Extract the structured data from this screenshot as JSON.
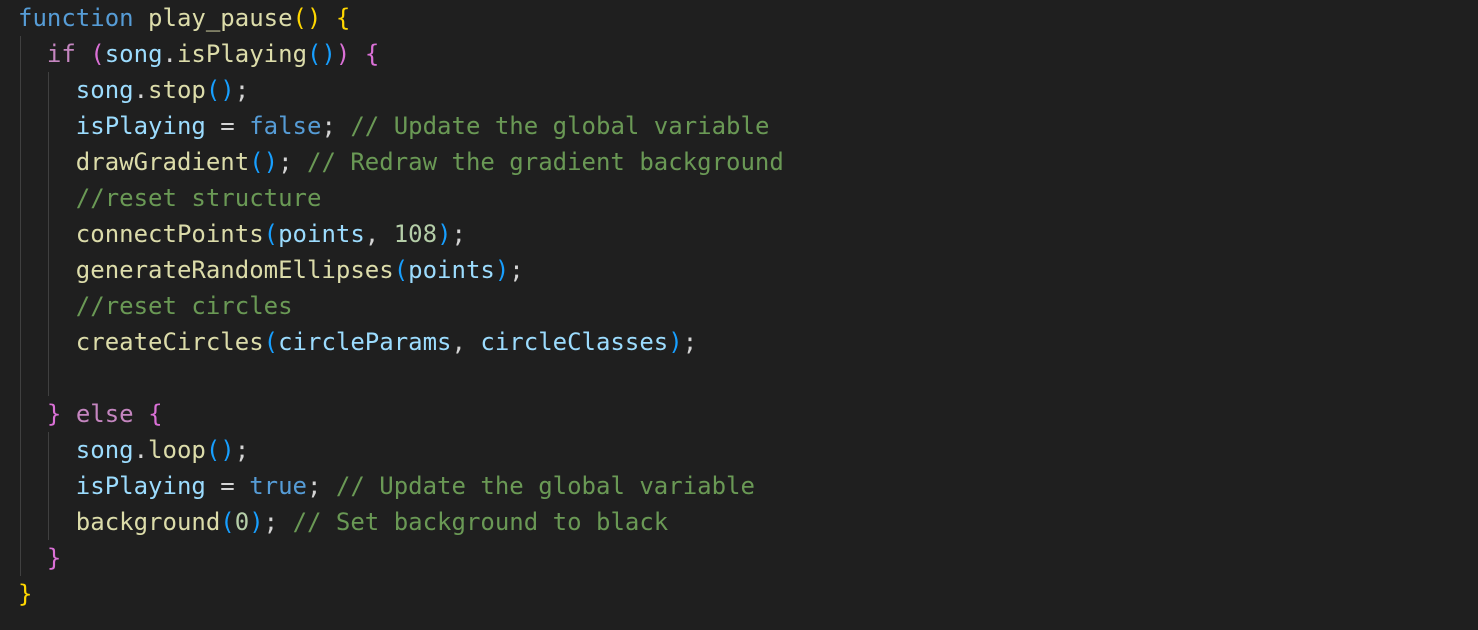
{
  "colors": {
    "background": "#1f1f1f",
    "keyword_blue": "#569cd6",
    "control_purple": "#c586c0",
    "function_yellow": "#dcdcaa",
    "variable_lightblue": "#9cdcfe",
    "comment_green": "#6a9955",
    "number_green": "#b5cea8",
    "punctuation": "#d4d4d4",
    "bracket_gold": "#ffd700",
    "bracket_purple": "#da70d6",
    "bracket_blue": "#179fff",
    "indent_guide": "#404040"
  },
  "code_lines": [
    [
      {
        "text": "function",
        "color": "#569cd6"
      },
      {
        "text": " ",
        "color": "#d4d4d4"
      },
      {
        "text": "play_pause",
        "color": "#dcdcaa"
      },
      {
        "text": "() {",
        "color": "#ffd700"
      }
    ],
    [
      {
        "text": "  ",
        "color": "#d4d4d4"
      },
      {
        "text": "if",
        "color": "#c586c0"
      },
      {
        "text": " ",
        "color": "#d4d4d4"
      },
      {
        "text": "(",
        "color": "#da70d6"
      },
      {
        "text": "song",
        "color": "#9cdcfe"
      },
      {
        "text": ".",
        "color": "#d4d4d4"
      },
      {
        "text": "isPlaying",
        "color": "#dcdcaa"
      },
      {
        "text": "()",
        "color": "#179fff"
      },
      {
        "text": ")",
        "color": "#da70d6"
      },
      {
        "text": " ",
        "color": "#d4d4d4"
      },
      {
        "text": "{",
        "color": "#da70d6"
      }
    ],
    [
      {
        "text": "    ",
        "color": "#d4d4d4"
      },
      {
        "text": "song",
        "color": "#9cdcfe"
      },
      {
        "text": ".",
        "color": "#d4d4d4"
      },
      {
        "text": "stop",
        "color": "#dcdcaa"
      },
      {
        "text": "()",
        "color": "#179fff"
      },
      {
        "text": ";",
        "color": "#d4d4d4"
      }
    ],
    [
      {
        "text": "    ",
        "color": "#d4d4d4"
      },
      {
        "text": "isPlaying",
        "color": "#9cdcfe"
      },
      {
        "text": " = ",
        "color": "#d4d4d4"
      },
      {
        "text": "false",
        "color": "#569cd6"
      },
      {
        "text": "; ",
        "color": "#d4d4d4"
      },
      {
        "text": "// Update the global variable",
        "color": "#6a9955"
      }
    ],
    [
      {
        "text": "    ",
        "color": "#d4d4d4"
      },
      {
        "text": "drawGradient",
        "color": "#dcdcaa"
      },
      {
        "text": "()",
        "color": "#179fff"
      },
      {
        "text": "; ",
        "color": "#d4d4d4"
      },
      {
        "text": "// Redraw the gradient background",
        "color": "#6a9955"
      }
    ],
    [
      {
        "text": "    ",
        "color": "#d4d4d4"
      },
      {
        "text": "//reset structure",
        "color": "#6a9955"
      }
    ],
    [
      {
        "text": "    ",
        "color": "#d4d4d4"
      },
      {
        "text": "connectPoints",
        "color": "#dcdcaa"
      },
      {
        "text": "(",
        "color": "#179fff"
      },
      {
        "text": "points",
        "color": "#9cdcfe"
      },
      {
        "text": ", ",
        "color": "#d4d4d4"
      },
      {
        "text": "108",
        "color": "#b5cea8"
      },
      {
        "text": ")",
        "color": "#179fff"
      },
      {
        "text": ";",
        "color": "#d4d4d4"
      }
    ],
    [
      {
        "text": "    ",
        "color": "#d4d4d4"
      },
      {
        "text": "generateRandomEllipses",
        "color": "#dcdcaa"
      },
      {
        "text": "(",
        "color": "#179fff"
      },
      {
        "text": "points",
        "color": "#9cdcfe"
      },
      {
        "text": ")",
        "color": "#179fff"
      },
      {
        "text": ";",
        "color": "#d4d4d4"
      }
    ],
    [
      {
        "text": "    ",
        "color": "#d4d4d4"
      },
      {
        "text": "//reset circles",
        "color": "#6a9955"
      }
    ],
    [
      {
        "text": "    ",
        "color": "#d4d4d4"
      },
      {
        "text": "createCircles",
        "color": "#dcdcaa"
      },
      {
        "text": "(",
        "color": "#179fff"
      },
      {
        "text": "circleParams",
        "color": "#9cdcfe"
      },
      {
        "text": ", ",
        "color": "#d4d4d4"
      },
      {
        "text": "circleClasses",
        "color": "#9cdcfe"
      },
      {
        "text": ")",
        "color": "#179fff"
      },
      {
        "text": ";",
        "color": "#d4d4d4"
      }
    ],
    [
      {
        "text": "",
        "color": "#d4d4d4"
      }
    ],
    [
      {
        "text": "  ",
        "color": "#d4d4d4"
      },
      {
        "text": "}",
        "color": "#da70d6"
      },
      {
        "text": " ",
        "color": "#d4d4d4"
      },
      {
        "text": "else",
        "color": "#c586c0"
      },
      {
        "text": " ",
        "color": "#d4d4d4"
      },
      {
        "text": "{",
        "color": "#da70d6"
      }
    ],
    [
      {
        "text": "    ",
        "color": "#d4d4d4"
      },
      {
        "text": "song",
        "color": "#9cdcfe"
      },
      {
        "text": ".",
        "color": "#d4d4d4"
      },
      {
        "text": "loop",
        "color": "#dcdcaa"
      },
      {
        "text": "()",
        "color": "#179fff"
      },
      {
        "text": ";",
        "color": "#d4d4d4"
      }
    ],
    [
      {
        "text": "    ",
        "color": "#d4d4d4"
      },
      {
        "text": "isPlaying",
        "color": "#9cdcfe"
      },
      {
        "text": " = ",
        "color": "#d4d4d4"
      },
      {
        "text": "true",
        "color": "#569cd6"
      },
      {
        "text": "; ",
        "color": "#d4d4d4"
      },
      {
        "text": "// Update the global variable",
        "color": "#6a9955"
      }
    ],
    [
      {
        "text": "    ",
        "color": "#d4d4d4"
      },
      {
        "text": "background",
        "color": "#dcdcaa"
      },
      {
        "text": "(",
        "color": "#179fff"
      },
      {
        "text": "0",
        "color": "#b5cea8"
      },
      {
        "text": ")",
        "color": "#179fff"
      },
      {
        "text": "; ",
        "color": "#d4d4d4"
      },
      {
        "text": "// Set background to black",
        "color": "#6a9955"
      }
    ],
    [
      {
        "text": "  ",
        "color": "#d4d4d4"
      },
      {
        "text": "}",
        "color": "#da70d6"
      }
    ],
    [
      {
        "text": "}",
        "color": "#ffd700"
      }
    ]
  ]
}
